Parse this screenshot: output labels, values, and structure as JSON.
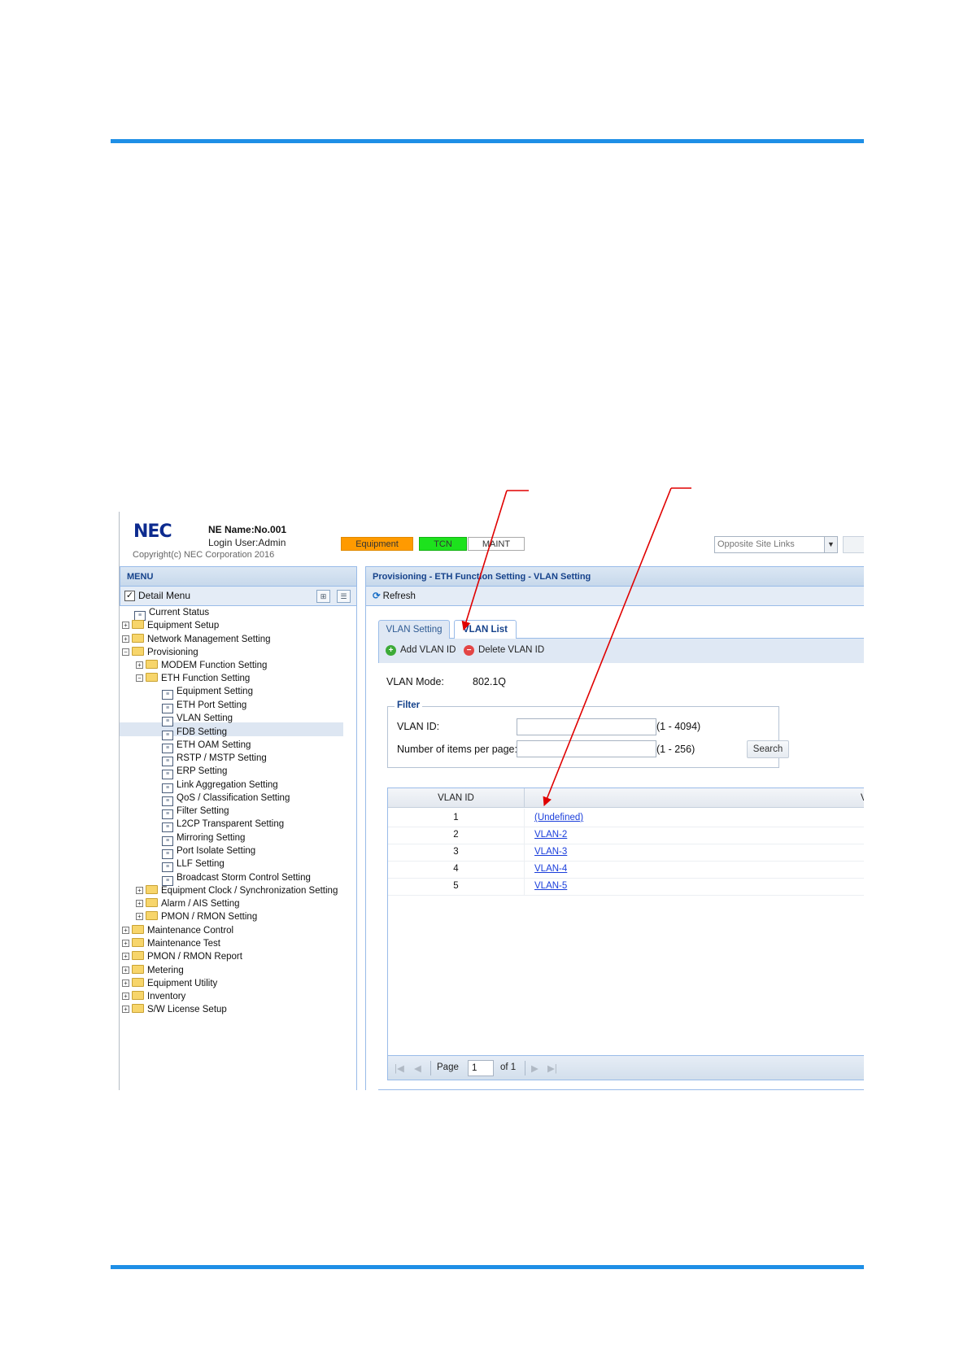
{
  "header": {
    "logo_text": "NEC",
    "ne_name": "NE Name:No.001",
    "login_user": "Login User:Admin",
    "copyright": "Copyright(c) NEC Corporation 2016",
    "status_equipment": "Equipment",
    "status_tcn": "TCN",
    "status_maint": "MAINT",
    "opposite_site_placeholder": "Opposite Site Links",
    "colors": {
      "equipment": "#ff9a00",
      "tcn": "#1de21d"
    }
  },
  "menu": {
    "title": "MENU",
    "detail_menu_label": "Detail Menu",
    "detail_menu_checked": true,
    "items": [
      {
        "label": "Current Status"
      },
      {
        "label": "Equipment Setup"
      },
      {
        "label": "Network Management Setting"
      },
      {
        "label": "Provisioning"
      },
      {
        "label": "MODEM Function Setting"
      },
      {
        "label": "ETH Function Setting"
      },
      {
        "label": "Equipment Setting"
      },
      {
        "label": "ETH Port Setting"
      },
      {
        "label": "VLAN Setting"
      },
      {
        "label": "FDB Setting"
      },
      {
        "label": "ETH OAM Setting"
      },
      {
        "label": "RSTP / MSTP Setting"
      },
      {
        "label": "ERP Setting"
      },
      {
        "label": "Link Aggregation Setting"
      },
      {
        "label": "QoS / Classification Setting"
      },
      {
        "label": "Filter Setting"
      },
      {
        "label": "L2CP Transparent Setting"
      },
      {
        "label": "Mirroring Setting"
      },
      {
        "label": "Port Isolate Setting"
      },
      {
        "label": "LLF Setting"
      },
      {
        "label": "Broadcast Storm Control Setting"
      },
      {
        "label": "Equipment Clock / Synchronization Setting"
      },
      {
        "label": "Alarm / AIS Setting"
      },
      {
        "label": "PMON / RMON Setting"
      },
      {
        "label": "Maintenance Control"
      },
      {
        "label": "Maintenance Test"
      },
      {
        "label": "PMON / RMON Report"
      },
      {
        "label": "Metering"
      },
      {
        "label": "Equipment Utility"
      },
      {
        "label": "Inventory"
      },
      {
        "label": "S/W License Setup"
      }
    ]
  },
  "main": {
    "breadcrumb": "Provisioning - ETH Function Setting - VLAN Setting",
    "refresh_label": "Refresh",
    "tabs": [
      {
        "label": "VLAN Setting"
      },
      {
        "label": "VLAN List"
      }
    ],
    "add_label": "Add VLAN ID",
    "delete_label": "Delete VLAN ID",
    "vlan_mode_label": "VLAN Mode:",
    "vlan_mode_value": "802.1Q",
    "filter": {
      "legend": "Filter",
      "vlan_id_label": "VLAN ID:",
      "vlan_id_value": "",
      "vlan_id_range": "(1 - 4094)",
      "items_label": "Number of items per page:",
      "items_value": "",
      "items_range": "(1 - 256)",
      "search_label": "Search"
    },
    "grid": {
      "columns": [
        "VLAN ID",
        "VL"
      ],
      "rows": [
        {
          "id": "1",
          "name": "(Undefined)"
        },
        {
          "id": "2",
          "name": "VLAN-2"
        },
        {
          "id": "3",
          "name": "VLAN-3"
        },
        {
          "id": "4",
          "name": "VLAN-4"
        },
        {
          "id": "5",
          "name": "VLAN-5"
        }
      ]
    },
    "pager": {
      "page_label": "Page",
      "page_value": "1",
      "of_label": "of 1"
    }
  },
  "annotation_color": "#e00000",
  "rule_color": "#1e8fe6"
}
